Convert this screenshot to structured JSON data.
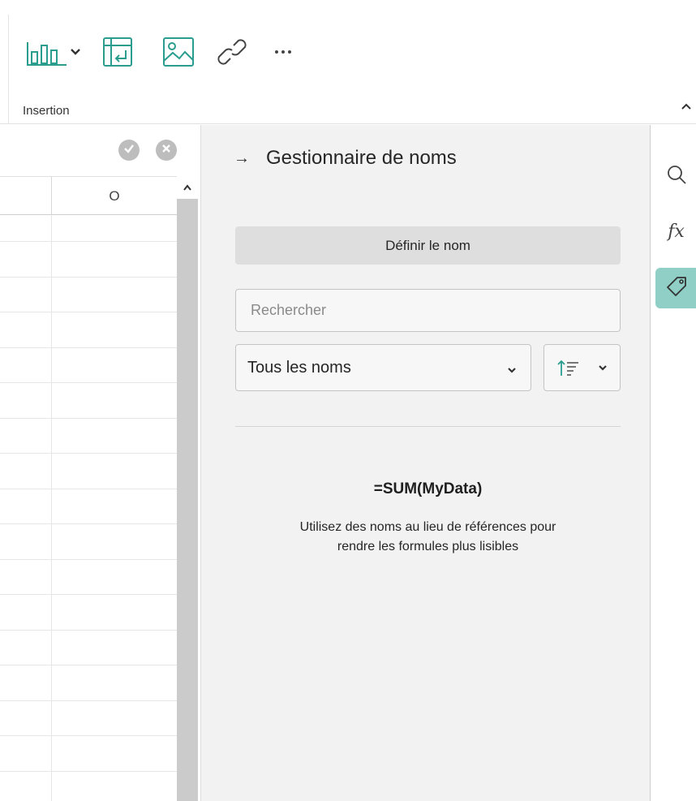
{
  "ribbon": {
    "group_label": "Insertion",
    "tools": [
      {
        "icon": "bar-chart-icon"
      },
      {
        "icon": "pivot-table-icon"
      },
      {
        "icon": "image-icon"
      },
      {
        "icon": "link-icon"
      },
      {
        "icon": "more-icon"
      }
    ]
  },
  "grid": {
    "column_header": "O"
  },
  "panel": {
    "title": "Gestionnaire de noms",
    "define_button": "Définir le nom",
    "search_placeholder": "Rechercher",
    "filter_value": "Tous les noms",
    "example_formula": "=SUM(MyData)",
    "help_line1": "Utilisez des noms au lieu de références pour",
    "help_line2": "rendre les formules plus lisibles"
  },
  "rail": {
    "items": [
      {
        "icon": "search-icon"
      },
      {
        "icon": "function-icon",
        "label": "fx"
      },
      {
        "icon": "tag-icon",
        "active": true
      }
    ]
  },
  "colors": {
    "accent": "#8fcfc6",
    "icon_teal": "#2a9d8f",
    "panel_bg": "#f2f2f2"
  }
}
